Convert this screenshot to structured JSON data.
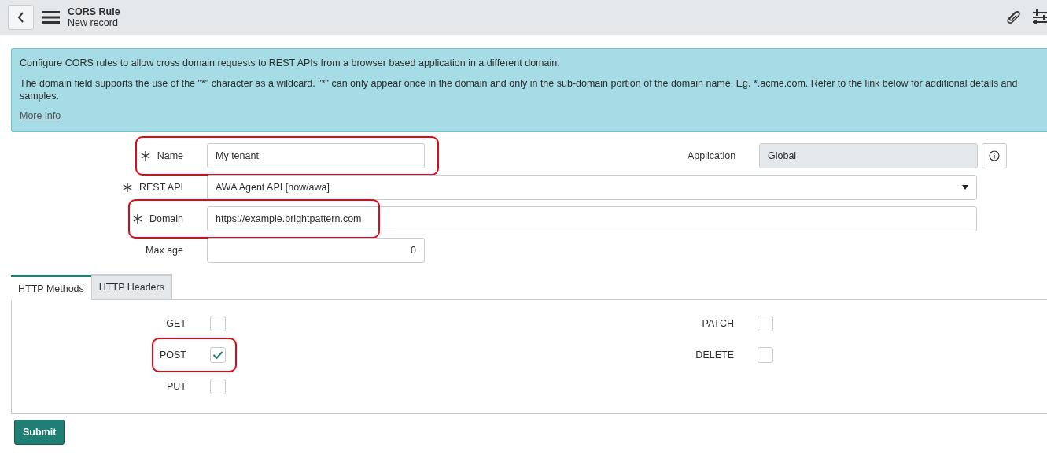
{
  "header": {
    "title": "CORS Rule",
    "subtitle": "New record"
  },
  "info": {
    "lines": [
      "Configure CORS rules to allow cross domain requests to REST APIs from a browser based application in a different domain.",
      "The domain field supports the use of the \"*\" character as a wildcard. \"*\" can only appear once in the domain and only in the sub-domain portion of the domain name. Eg. *.acme.com. Refer to the link below for additional details and samples."
    ],
    "link": "More info"
  },
  "fields": [
    {
      "label": "Name",
      "required": true,
      "kind": "text",
      "value": "My tenant",
      "highlighted": true
    },
    {
      "label": "REST API",
      "required": true,
      "kind": "select",
      "value": "AWA Agent API [now/awa]",
      "highlighted": false
    },
    {
      "label": "Domain",
      "required": true,
      "kind": "text",
      "value": "https://example.brightpattern.com",
      "highlighted": true
    },
    {
      "label": "Max age",
      "required": false,
      "kind": "number",
      "value": "0",
      "highlighted": false
    }
  ],
  "application": {
    "label": "Application",
    "value": "Global"
  },
  "tabs": [
    {
      "label": "HTTP Methods",
      "selected": true
    },
    {
      "label": "HTTP Headers",
      "selected": false
    }
  ],
  "methods": [
    {
      "label": "GET",
      "checked": false,
      "highlighted": false
    },
    {
      "label": "PATCH",
      "checked": false,
      "highlighted": false
    },
    {
      "label": "POST",
      "checked": true,
      "highlighted": true
    },
    {
      "label": "DELETE",
      "checked": false,
      "highlighted": false
    },
    {
      "label": "PUT",
      "checked": false,
      "highlighted": false
    }
  ],
  "submit": "Submit"
}
